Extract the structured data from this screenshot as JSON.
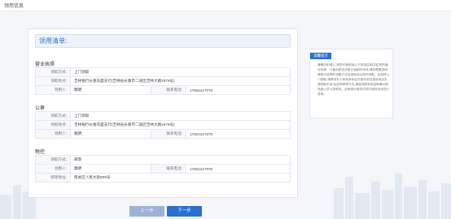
{
  "breadcrumb": "领用信息",
  "main": {
    "title": "领用清单:",
    "sections": [
      {
        "name": "营业执照",
        "rows": [
          {
            "label": "领取方式:",
            "value": "上门领取"
          },
          {
            "label": "领取地点:",
            "value": "吉林银行长春东盛支行(吉林省长春市二道区吉林大路1979号)"
          },
          {
            "label": "领用人:",
            "value": "魏明",
            "label2": "联系电话:",
            "value2": "17604417076"
          }
        ]
      },
      {
        "name": "公章",
        "rows": [
          {
            "label": "领取方式:",
            "value": "上门领取"
          },
          {
            "label": "领取地点:",
            "value": "吉林银行长春东盛支行(吉林省长春市二道区吉林大路1979号)"
          },
          {
            "label": "领用人:",
            "value": "魏明",
            "label2": "联系电话:",
            "value2": "17604417076"
          }
        ]
      },
      {
        "name": "税控",
        "rows": [
          {
            "label": "领取方式:",
            "value": "邮寄"
          },
          {
            "label": "领用人:",
            "value": "魏明",
            "label2": "联系电话:",
            "value2": "17604417076"
          },
          {
            "label": "邮寄地址:",
            "value": "南关区人民大街909号"
          }
        ]
      }
    ]
  },
  "buttons": {
    "prev": "上一步",
    "next": "下一步"
  },
  "tip": {
    "tag": "温馨提示",
    "text": "尊敬的申请人,请您仔细阅读以下领用告知内容:您的营业执照、公章及税控设备已经制作完成,请您根据领用清单中选择的领取方式及领取地点按时领取。如选择上门领取,请携带本人有效身份证件原件前往指定地点办理领取手续;如选择邮寄方式,请保持联系电话畅通以便快递人员与您联系。如有疑问请及时拨打服务热线进行咨询。"
  },
  "colors": {
    "accent": "#2a6fd1",
    "prev_button": "#9bb3d6"
  }
}
